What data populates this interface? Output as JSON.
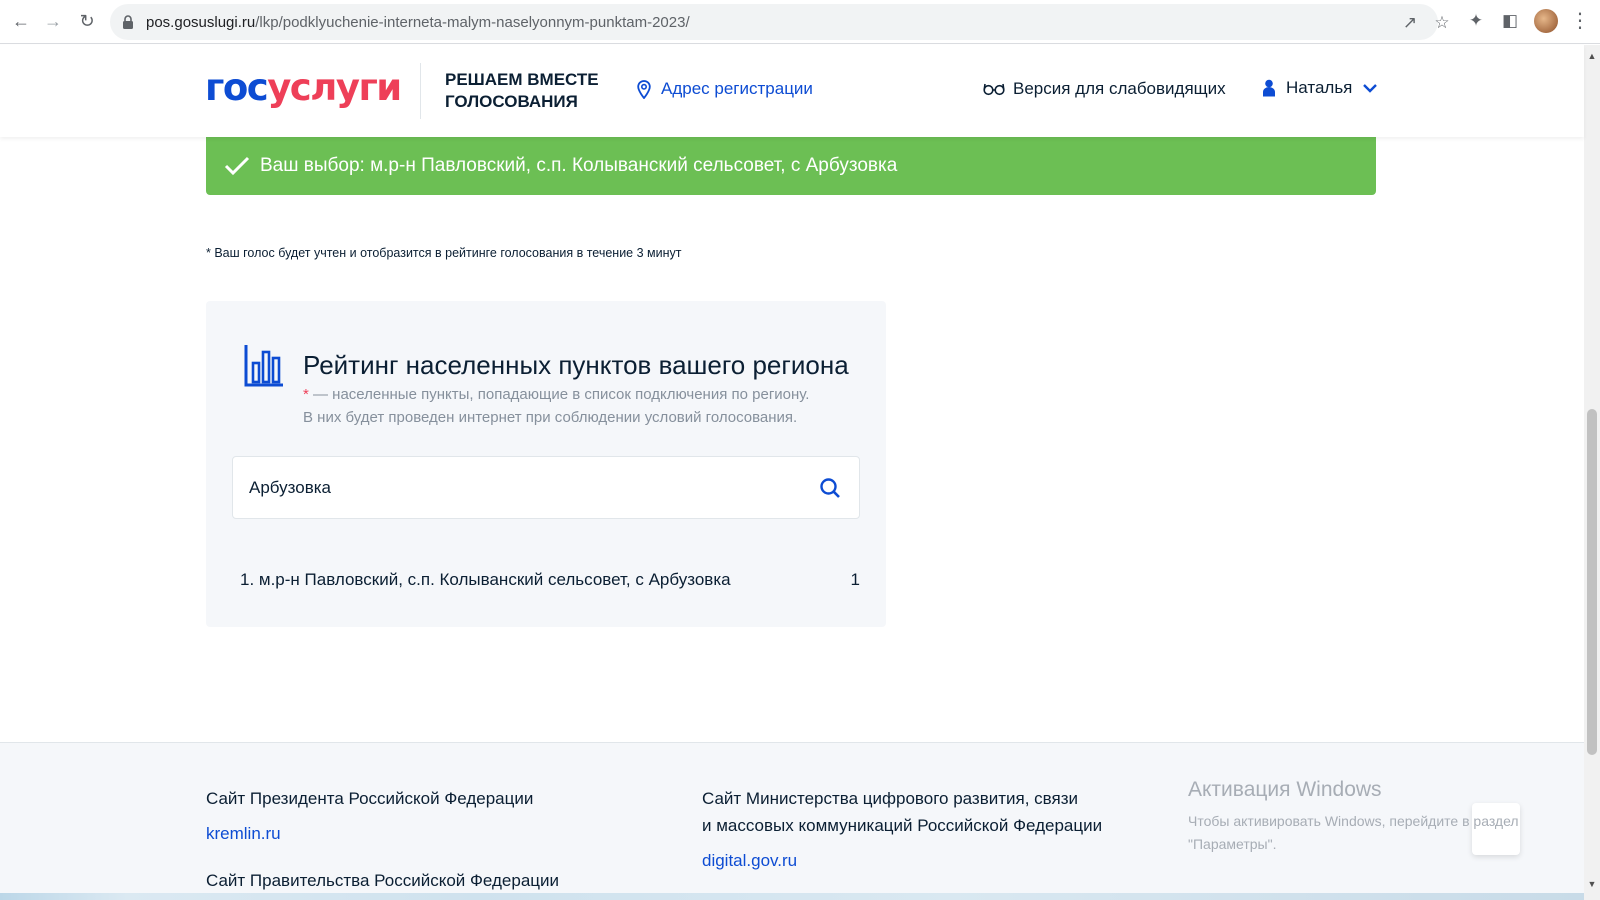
{
  "browser": {
    "url_host": "pos.gosuslugi.ru",
    "url_path": "/lkp/podklyuchenie-interneta-malym-naselyonnym-punktam-2023/"
  },
  "header": {
    "logo_part1": "гос",
    "logo_part2": "услуги",
    "promo_line1": "РЕШАЕМ ВМЕСТЕ",
    "promo_line2": "ГОЛОСОВАНИЯ",
    "address_link": "Адрес регистрации",
    "vision_link": "Версия для слабовидящих",
    "user_name": "Наталья"
  },
  "banner": {
    "text": "Ваш выбор: м.р-н Павловский, с.п. Колыванский сельсовет, с Арбузовка"
  },
  "vote_note": "* Ваш голос будет учтен и отобразится в рейтинге голосования в течение 3 минут",
  "rating": {
    "title": "Рейтинг населенных пунктов вашего региона",
    "desc_star": "*",
    "desc_line1": " — населенные пункты, попадающие в список подключения по региону.",
    "desc_line2": "В них будет проведен интернет при соблюдении условий голосования.",
    "search_value": "Арбузовка",
    "results": [
      {
        "label": "1. м.р-н Павловский, с.п. Колыванский сельсовет, с Арбузовка",
        "votes": "1"
      }
    ]
  },
  "footer": {
    "president_label": "Сайт Президента Российской Федерации",
    "president_link": "kremlin.ru",
    "government_label": "Сайт Правительства Российской Федерации",
    "ministry_line1": "Сайт Министерства цифрового развития, связи",
    "ministry_line2": "и массовых коммуникаций Российской Федерации",
    "ministry_link": "digital.gov.ru"
  },
  "watermark": {
    "title": "Активация Windows",
    "line1": "Чтобы активировать Windows, перейдите в раздел",
    "line2": "\"Параметры\"."
  },
  "colors": {
    "brand_blue": "#0d4cd3",
    "brand_red": "#ee3f58",
    "success_green": "#6cbf54"
  }
}
